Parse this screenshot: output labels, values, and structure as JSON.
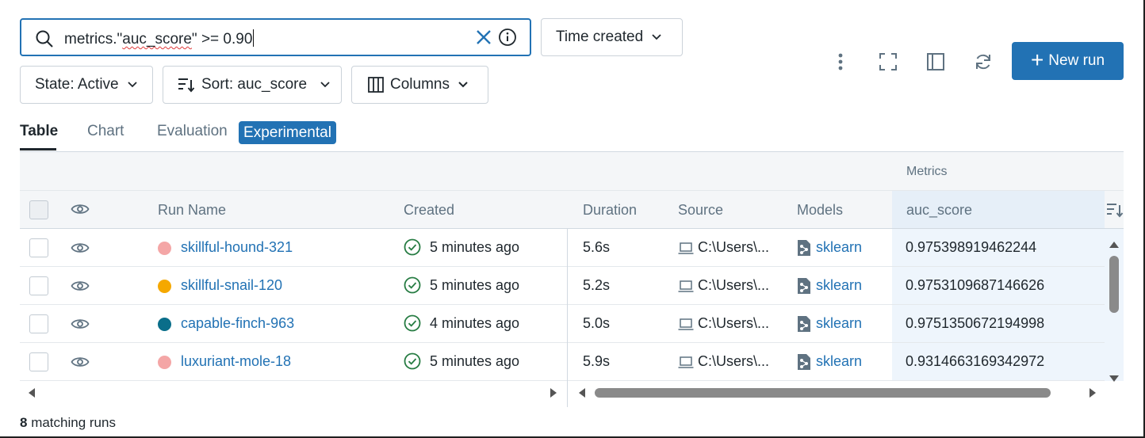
{
  "search": {
    "prefix": "metrics.\"",
    "squiggle": "auc_score",
    "suffix": "\" >= 0.90"
  },
  "toolbar": {
    "time_created_label": "Time created",
    "state_label": "State: Active",
    "sort_label": "Sort: auc_score",
    "columns_label": "Columns",
    "new_run_label": "New run"
  },
  "tabs": [
    {
      "label": "Table",
      "active": true
    },
    {
      "label": "Chart",
      "active": false
    },
    {
      "label": "Evaluation",
      "active": false
    },
    {
      "label": "Experimental",
      "active": false
    }
  ],
  "table": {
    "group_label": "Metrics",
    "headers": {
      "run_name": "Run Name",
      "created": "Created",
      "duration": "Duration",
      "source": "Source",
      "models": "Models",
      "metric": "auc_score"
    },
    "rows": [
      {
        "name": "skillful-hound-321",
        "color": "#f4a6a6",
        "created": "5 minutes ago",
        "duration": "5.6s",
        "source": "C:\\Users\\...",
        "model": "sklearn",
        "auc": "0.975398919462244"
      },
      {
        "name": "skillful-snail-120",
        "color": "#f5a800",
        "created": "5 minutes ago",
        "duration": "5.2s",
        "source": "C:\\Users\\...",
        "model": "sklearn",
        "auc": "0.9753109687146626"
      },
      {
        "name": "capable-finch-963",
        "color": "#0a6e8a",
        "created": "4 minutes ago",
        "duration": "5.0s",
        "source": "C:\\Users\\...",
        "model": "sklearn",
        "auc": "0.9751350672194998"
      },
      {
        "name": "luxuriant-mole-18",
        "color": "#f4a6a6",
        "created": "5 minutes ago",
        "duration": "5.9s",
        "source": "C:\\Users\\...",
        "model": "sklearn",
        "auc": "0.9314663169342972"
      }
    ]
  },
  "footer": {
    "count": "8",
    "label": " matching runs"
  },
  "colors": {
    "accent": "#2272b4",
    "success": "#277c43"
  }
}
